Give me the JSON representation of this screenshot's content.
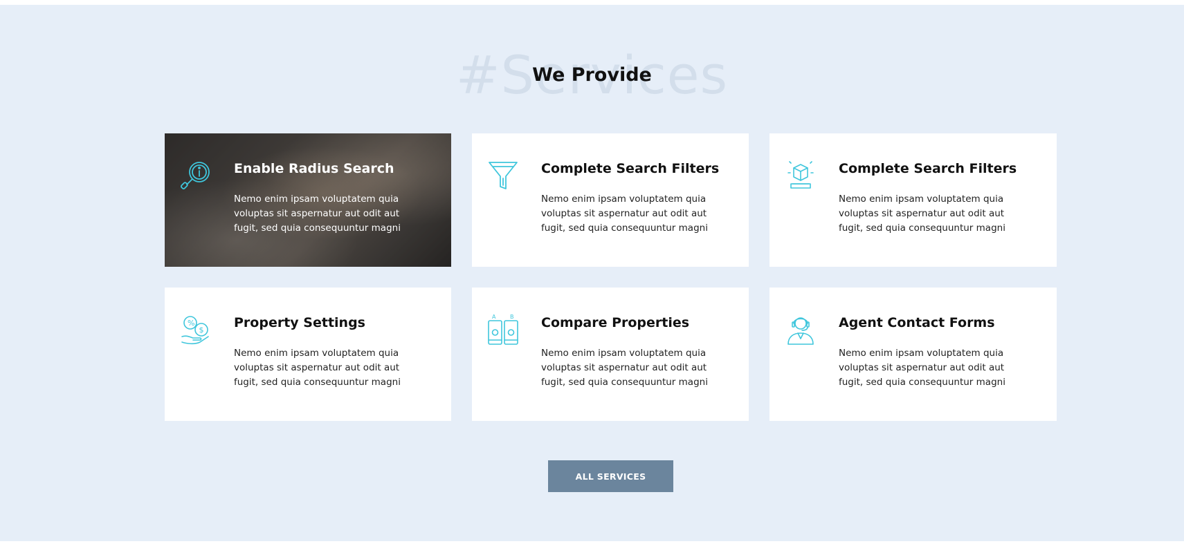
{
  "section": {
    "watermark": "#Services",
    "heading": "We Provide"
  },
  "colors": {
    "background": "#e6eef8",
    "accent_icon": "#3fc6dc",
    "button": "#6b859d"
  },
  "cards": [
    {
      "title": "Enable Radius Search",
      "description": "Nemo enim ipsam voluptatem quia voluptas sit aspernatur aut odit aut fugit, sed quia consequuntur magni",
      "icon": "magnifier-info-icon",
      "active": true
    },
    {
      "title": "Complete Search Filters",
      "description": "Nemo enim ipsam voluptatem quia voluptas sit aspernatur aut odit aut fugit, sed quia consequuntur magni",
      "icon": "funnel-icon",
      "active": false
    },
    {
      "title": "Complete Search Filters",
      "description": "Nemo enim ipsam voluptatem quia voluptas sit aspernatur aut odit aut fugit, sed quia consequuntur magni",
      "icon": "box-sparkle-icon",
      "active": false
    },
    {
      "title": "Property Settings",
      "description": "Nemo enim ipsam voluptatem quia voluptas sit aspernatur aut odit aut fugit, sed quia consequuntur magni",
      "icon": "money-hand-icon",
      "active": false
    },
    {
      "title": "Compare Properties",
      "description": "Nemo enim ipsam voluptatem quia voluptas sit aspernatur aut odit aut fugit, sed quia consequuntur magni",
      "icon": "compare-ab-icon",
      "active": false
    },
    {
      "title": "Agent Contact Forms",
      "description": "Nemo enim ipsam voluptatem quia voluptas sit aspernatur aut odit aut fugit, sed quia consequuntur magni",
      "icon": "agent-headset-icon",
      "active": false
    }
  ],
  "button": {
    "label": "ALL SERVICES"
  }
}
